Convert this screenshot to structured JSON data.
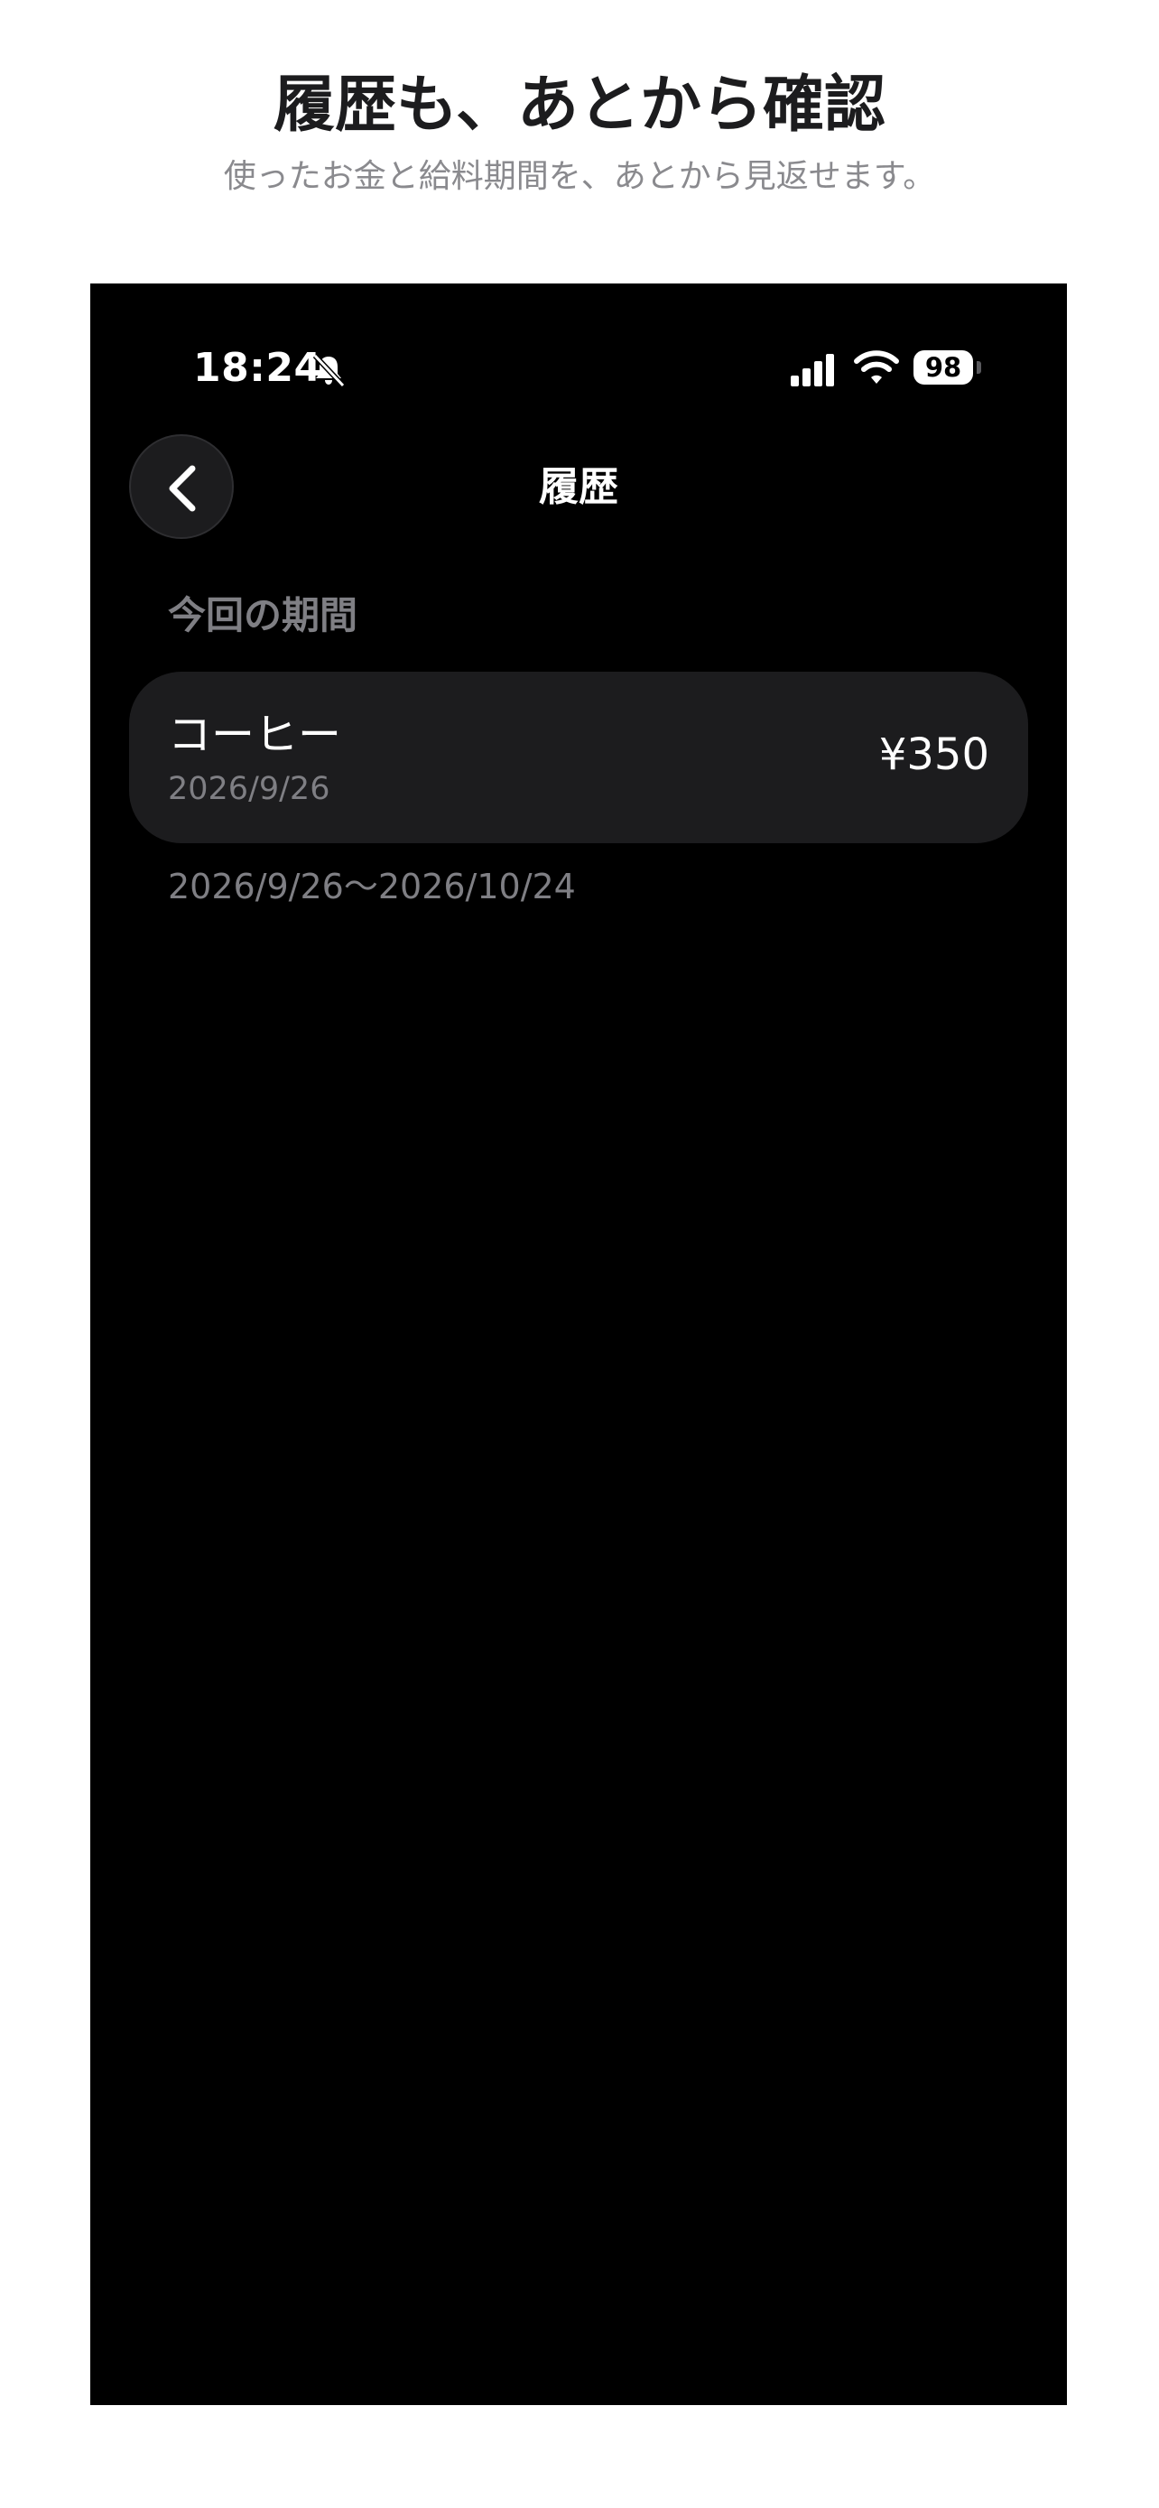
{
  "promo": {
    "title": "履歴も、あとから確認",
    "subtitle": "使ったお金と給料期間を、あとから見返せます。"
  },
  "status_bar": {
    "time": "18:24",
    "silent_icon": "bell-slash-icon",
    "signal_icon": "cellular-signal-icon",
    "wifi_icon": "wifi-icon",
    "battery_level": "98"
  },
  "nav": {
    "back_icon": "chevron-left-icon",
    "title": "履歴"
  },
  "section": {
    "header": "今回の期間",
    "items": [
      {
        "name": "コーヒー",
        "date": "2026/9/26",
        "amount": "¥350"
      }
    ],
    "period": "2026/9/26〜2026/10/24"
  },
  "colors": {
    "background": "#000000",
    "card": "#1c1c1e",
    "secondary_text": "#7f7f84",
    "primary_text": "#ffffff"
  }
}
